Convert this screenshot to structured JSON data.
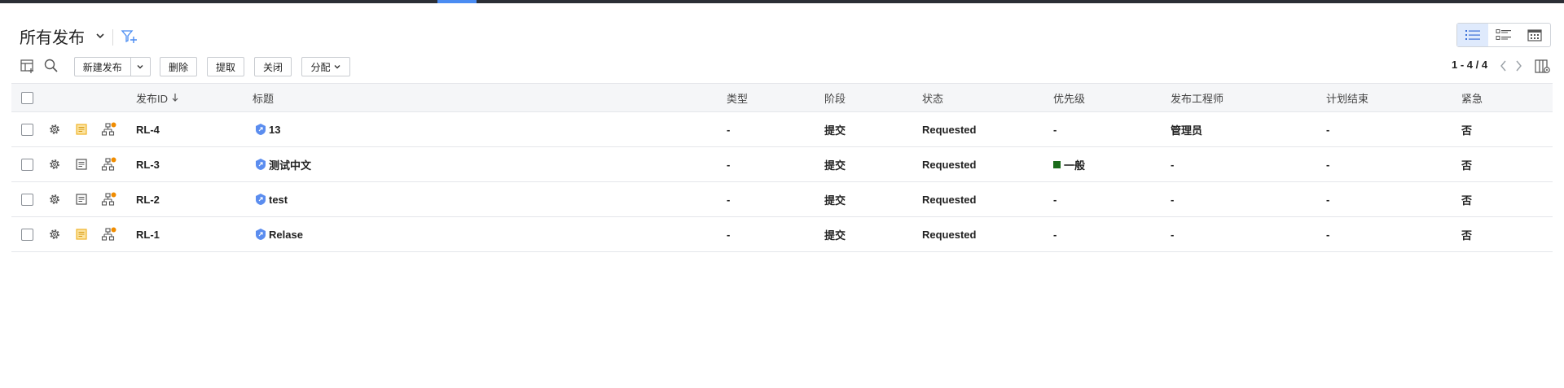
{
  "header": {
    "view_title": "所有发布"
  },
  "toolbar": {
    "new_release": "新建发布",
    "delete": "删除",
    "extract": "提取",
    "close": "关闭",
    "assign": "分配"
  },
  "pager": {
    "range": "1 - 4 / 4"
  },
  "columns": {
    "id": "发布ID",
    "title": "标题",
    "type": "类型",
    "stage": "阶段",
    "status": "状态",
    "priority": "优先级",
    "engineer": "发布工程师",
    "planned_end": "计划结束",
    "urgent": "紧急"
  },
  "rows": [
    {
      "id": "RL-4",
      "title": "13",
      "type": "-",
      "stage": "提交",
      "status": "Requested",
      "priority": "-",
      "engineer": "管理员",
      "planned_end": "-",
      "urgent": "否"
    },
    {
      "id": "RL-3",
      "title": "测试中文",
      "type": "-",
      "stage": "提交",
      "status": "Requested",
      "priority": "一般",
      "engineer": "-",
      "planned_end": "-",
      "urgent": "否"
    },
    {
      "id": "RL-2",
      "title": "test",
      "type": "-",
      "stage": "提交",
      "status": "Requested",
      "priority": "-",
      "engineer": "-",
      "planned_end": "-",
      "urgent": "否"
    },
    {
      "id": "RL-1",
      "title": "Relase",
      "type": "-",
      "stage": "提交",
      "status": "Requested",
      "priority": "-",
      "engineer": "-",
      "planned_end": "-",
      "urgent": "否"
    }
  ],
  "colors": {
    "accent": "#4a8cf2",
    "note_yellow": "#f0b429",
    "badge_orange": "#f08c00",
    "priority_green": "#1a6b1a"
  },
  "icons": {
    "gear": "gear-icon",
    "note": "note-icon",
    "hierarchy": "hierarchy-icon",
    "release": "release-shield-icon"
  }
}
